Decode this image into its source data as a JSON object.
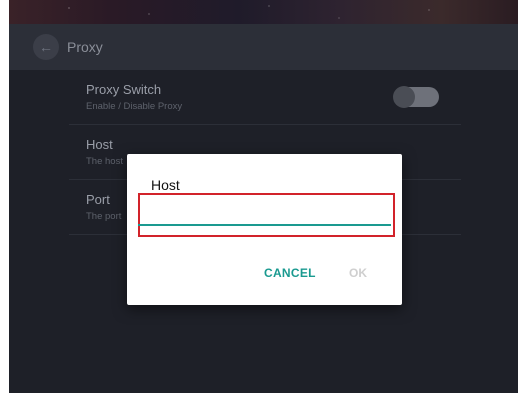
{
  "app_bar": {
    "title": "Proxy"
  },
  "settings": [
    {
      "title": "Proxy Switch",
      "subtitle": "Enable / Disable Proxy",
      "toggle_on": false
    },
    {
      "title": "Host",
      "subtitle": "The host"
    },
    {
      "title": "Port",
      "subtitle": "The port"
    }
  ],
  "dialog": {
    "title": "Host",
    "input_value": "",
    "cancel_label": "CANCEL",
    "ok_label": "OK"
  },
  "colors": {
    "accent": "#1a9a90",
    "highlight": "#d2232a"
  },
  "icons": {
    "back": "arrow-left-icon"
  }
}
